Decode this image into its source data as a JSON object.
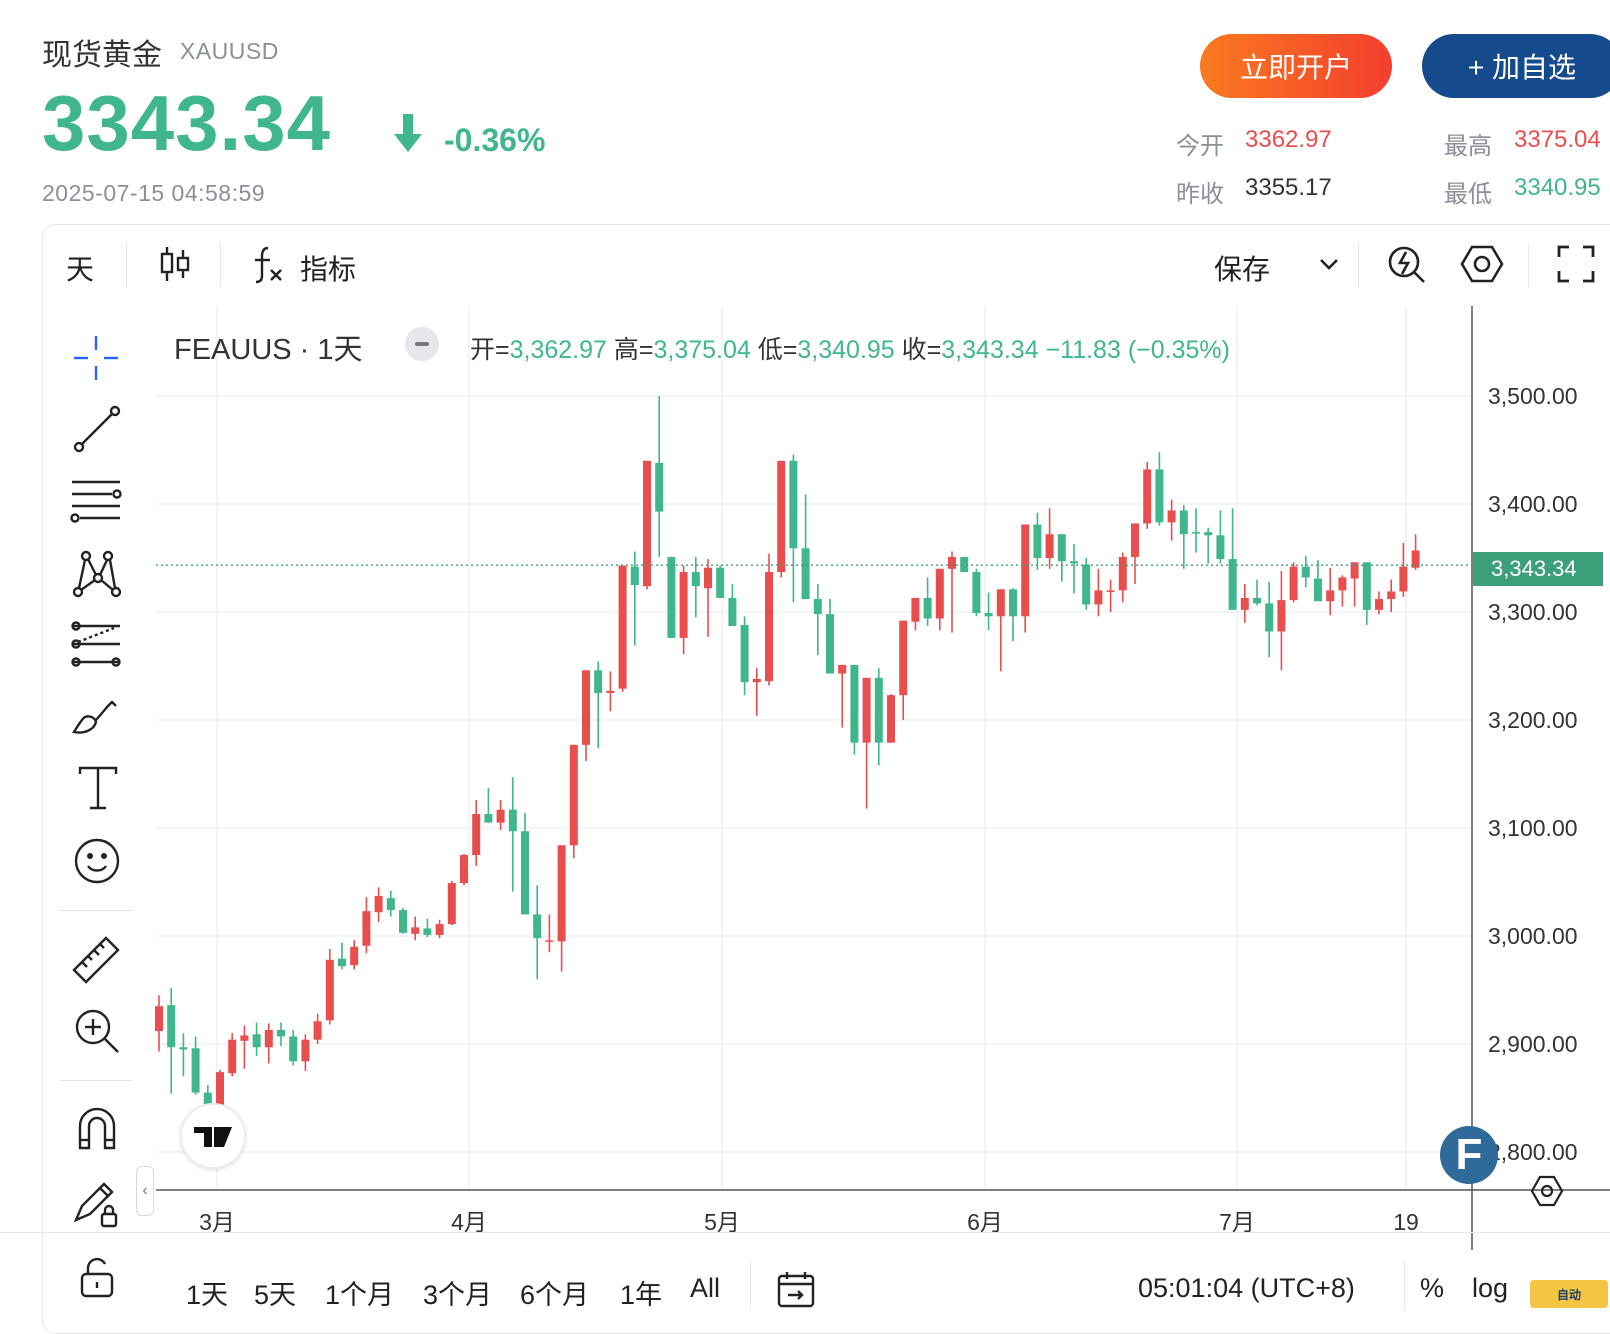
{
  "header": {
    "title": "现货黄金",
    "symbol": "XAUUSD",
    "price": "3343.34",
    "change_pct": "-0.36%",
    "timestamp": "2025-07-15 04:58:59",
    "open_account_label": "立即开户",
    "add_watch_label": "+ 加自选"
  },
  "quote": {
    "open_label": "今开",
    "open_value": "3362.97",
    "high_label": "最高",
    "high_value": "3375.04",
    "prev_close_label": "昨收",
    "prev_close_value": "3355.17",
    "low_label": "最低",
    "low_value": "3340.95"
  },
  "toolbar": {
    "interval": "天",
    "indicators_label": "指标",
    "save_label": "保存"
  },
  "legend": {
    "title": "FEAUUS · 1天",
    "open_key": "开=",
    "open_val": "3,362.97",
    "high_key": "高=",
    "high_val": "3,375.04",
    "low_key": "低=",
    "low_val": "3,340.95",
    "close_key": "收=",
    "close_val": "3,343.34",
    "change": "−11.83 (−0.35%)"
  },
  "ranges": [
    "1天",
    "5天",
    "1个月",
    "3个月",
    "6个月",
    "1年",
    "All"
  ],
  "bottom": {
    "time": "05:01:04 (UTC+8)",
    "percent": "%",
    "log": "log",
    "auto": "自动"
  },
  "colors": {
    "up": "#e94e4e",
    "down": "#3fb68b",
    "accent": "#154a8c"
  },
  "chart_data": {
    "type": "candlestick",
    "ylim": [
      2770,
      3560
    ],
    "yticks": [
      "3,500.00",
      "3,400.00",
      "3,300.00",
      "3,200.00",
      "3,100.00",
      "3,000.00",
      "2,900.00",
      "2,800.00"
    ],
    "ytick_values": [
      3500,
      3400,
      3300,
      3200,
      3100,
      3000,
      2900,
      2800
    ],
    "current_price_label": "3,343.34",
    "current_price": 3343.34,
    "xticks": [
      "3月",
      "4月",
      "5月",
      "6月",
      "7月",
      "19"
    ],
    "candles": [
      [
        2912,
        2945,
        2893,
        2935
      ],
      [
        2936,
        2952,
        2854,
        2897
      ],
      [
        2897,
        2910,
        2870,
        2895
      ],
      [
        2896,
        2907,
        2853,
        2855
      ],
      [
        2855,
        2862,
        2832,
        2835
      ],
      [
        2836,
        2876,
        2823,
        2874
      ],
      [
        2873,
        2910,
        2870,
        2904
      ],
      [
        2903,
        2917,
        2877,
        2908
      ],
      [
        2909,
        2920,
        2889,
        2897
      ],
      [
        2897,
        2919,
        2882,
        2913
      ],
      [
        2913,
        2920,
        2898,
        2907
      ],
      [
        2907,
        2913,
        2880,
        2884
      ],
      [
        2884,
        2909,
        2875,
        2904
      ],
      [
        2904,
        2928,
        2900,
        2921
      ],
      [
        2922,
        2988,
        2918,
        2978
      ],
      [
        2979,
        2994,
        2969,
        2972
      ],
      [
        2973,
        2996,
        2969,
        2990
      ],
      [
        2991,
        3036,
        2984,
        3023
      ],
      [
        3022,
        3045,
        3013,
        3037
      ],
      [
        3035,
        3042,
        3018,
        3024
      ],
      [
        3024,
        3026,
        3002,
        3003
      ],
      [
        3002,
        3018,
        2996,
        3008
      ],
      [
        3007,
        3016,
        2999,
        3001
      ],
      [
        3001,
        3015,
        2998,
        3011
      ],
      [
        3011,
        3051,
        3010,
        3049
      ],
      [
        3049,
        3076,
        3047,
        3075
      ],
      [
        3075,
        3126,
        3065,
        3113
      ],
      [
        3113,
        3137,
        3108,
        3105
      ],
      [
        3105,
        3126,
        3098,
        3117
      ],
      [
        3117,
        3147,
        3041,
        3097
      ],
      [
        3097,
        3114,
        3023,
        3020
      ],
      [
        3020,
        3047,
        2960,
        2998
      ],
      [
        2995,
        3020,
        2985,
        2996
      ],
      [
        2995,
        3076,
        2967,
        3084
      ],
      [
        3084,
        3145,
        3072,
        3177
      ],
      [
        3177,
        3230,
        3162,
        3246
      ],
      [
        3246,
        3254,
        3174,
        3225
      ],
      [
        3225,
        3245,
        3208,
        3227
      ],
      [
        3229,
        3339,
        3226,
        3343
      ],
      [
        3342,
        3356,
        3269,
        3325
      ],
      [
        3324,
        3435,
        3321,
        3440
      ],
      [
        3438,
        3500,
        3351,
        3393
      ],
      [
        3351,
        3348,
        3289,
        3276
      ],
      [
        3276,
        3343,
        3261,
        3337
      ],
      [
        3337,
        3351,
        3295,
        3324
      ],
      [
        3322,
        3349,
        3277,
        3341
      ],
      [
        3341,
        3343,
        3313,
        3313
      ],
      [
        3313,
        3326,
        3296,
        3287
      ],
      [
        3288,
        3296,
        3223,
        3235
      ],
      [
        3235,
        3248,
        3204,
        3238
      ],
      [
        3236,
        3354,
        3232,
        3337
      ],
      [
        3337,
        3417,
        3332,
        3440
      ],
      [
        3440,
        3446,
        3309,
        3359
      ],
      [
        3359,
        3409,
        3320,
        3312
      ],
      [
        3312,
        3326,
        3260,
        3298
      ],
      [
        3298,
        3312,
        3253,
        3243
      ],
      [
        3243,
        3248,
        3193,
        3251
      ],
      [
        3251,
        3251,
        3168,
        3179
      ],
      [
        3179,
        3223,
        3118,
        3239
      ],
      [
        3239,
        3248,
        3158,
        3179
      ],
      [
        3179,
        3224,
        3206,
        3223
      ],
      [
        3223,
        3233,
        3200,
        3292
      ],
      [
        3291,
        3308,
        3283,
        3313
      ],
      [
        3313,
        3332,
        3287,
        3294
      ],
      [
        3294,
        3329,
        3283,
        3340
      ],
      [
        3340,
        3356,
        3281,
        3351
      ],
      [
        3351,
        3338,
        3337,
        3337
      ],
      [
        3337,
        3340,
        3296,
        3299
      ],
      [
        3299,
        3318,
        3283,
        3296
      ],
      [
        3296,
        3318,
        3245,
        3321
      ],
      [
        3321,
        3322,
        3273,
        3296
      ],
      [
        3296,
        3344,
        3281,
        3381
      ],
      [
        3381,
        3392,
        3339,
        3350
      ],
      [
        3350,
        3396,
        3340,
        3372
      ],
      [
        3372,
        3372,
        3328,
        3347
      ],
      [
        3347,
        3363,
        3317,
        3345
      ],
      [
        3344,
        3350,
        3302,
        3307
      ],
      [
        3307,
        3340,
        3296,
        3320
      ],
      [
        3320,
        3330,
        3300,
        3320
      ],
      [
        3320,
        3355,
        3309,
        3351
      ],
      [
        3351,
        3362,
        3326,
        3382
      ],
      [
        3382,
        3439,
        3377,
        3432
      ],
      [
        3432,
        3448,
        3380,
        3383
      ],
      [
        3383,
        3404,
        3366,
        3394
      ],
      [
        3394,
        3399,
        3340,
        3372
      ],
      [
        3374,
        3396,
        3355,
        3373
      ],
      [
        3374,
        3378,
        3345,
        3371
      ],
      [
        3371,
        3394,
        3345,
        3349
      ],
      [
        3349,
        3396,
        3312,
        3302
      ],
      [
        3302,
        3326,
        3290,
        3313
      ],
      [
        3313,
        3330,
        3306,
        3308
      ],
      [
        3308,
        3328,
        3258,
        3282
      ],
      [
        3282,
        3338,
        3246,
        3311
      ],
      [
        3311,
        3346,
        3309,
        3342
      ],
      [
        3342,
        3352,
        3323,
        3332
      ],
      [
        3331,
        3348,
        3313,
        3310
      ],
      [
        3310,
        3341,
        3297,
        3320
      ],
      [
        3320,
        3334,
        3305,
        3332
      ],
      [
        3331,
        3345,
        3305,
        3346
      ],
      [
        3346,
        3346,
        3288,
        3302
      ],
      [
        3302,
        3319,
        3298,
        3312
      ],
      [
        3312,
        3330,
        3300,
        3319
      ],
      [
        3319,
        3364,
        3314,
        3342
      ],
      [
        3341,
        3372,
        3339,
        3357
      ]
    ]
  }
}
